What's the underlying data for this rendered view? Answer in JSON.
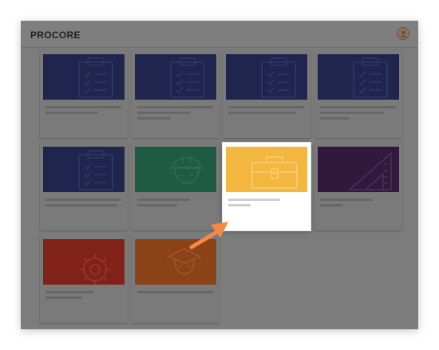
{
  "app": {
    "logo_text": "PROCORE"
  },
  "colors": {
    "checklist": "#1f254d",
    "safety": "#1f5a45",
    "toolbox": "#f3b63f",
    "ruler": "#31183d",
    "gear": "#802218",
    "worker": "#8a4216",
    "pointer_arrow": "#f58a45"
  },
  "cards": [
    {
      "icon": "clipboard-checklist-icon",
      "highlighted": false
    },
    {
      "icon": "clipboard-checklist-icon",
      "highlighted": false
    },
    {
      "icon": "clipboard-checklist-icon",
      "highlighted": false
    },
    {
      "icon": "clipboard-checklist-icon",
      "highlighted": false
    },
    {
      "icon": "clipboard-checklist-icon",
      "highlighted": false
    },
    {
      "icon": "hard-hat-worker-icon",
      "highlighted": false
    },
    {
      "icon": "toolbox-icon",
      "highlighted": true
    },
    {
      "icon": "triangle-ruler-icon",
      "highlighted": false
    },
    {
      "icon": "gear-icon",
      "highlighted": false
    },
    {
      "icon": "worker-icon",
      "highlighted": false
    }
  ],
  "pointer": {
    "icon": "arrow-pointer-icon"
  }
}
